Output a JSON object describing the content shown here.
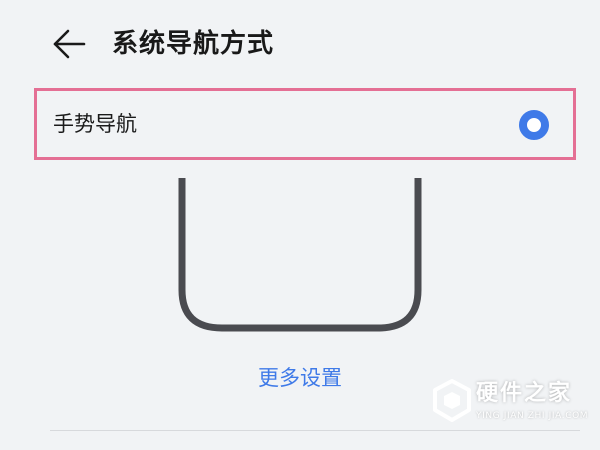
{
  "header": {
    "title": "系统导航方式",
    "back_icon": "arrow-left-icon"
  },
  "option": {
    "label": "手势导航",
    "selected": true
  },
  "links": {
    "more_settings": "更多设置"
  },
  "watermark": {
    "name": "硬件之家",
    "sub": "YING JIAN ZHI JIA.COM"
  },
  "colors": {
    "background": "#f1f3f5",
    "accent": "#3f7ae8",
    "highlight_border": "#e46f94",
    "phone_outline": "#4a4b50"
  }
}
